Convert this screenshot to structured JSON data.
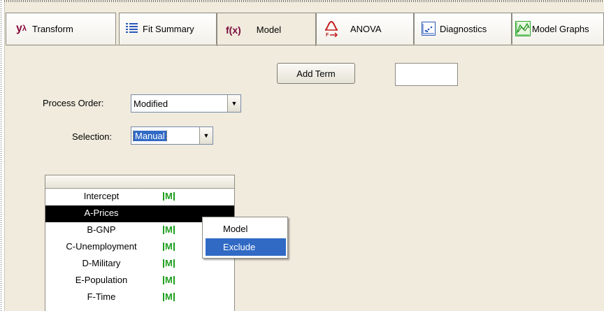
{
  "tabs": [
    {
      "label": "Transform",
      "icon": "y-lambda-icon",
      "glyph": "yλ"
    },
    {
      "label": "Fit Summary",
      "icon": "list-icon"
    },
    {
      "label": "Model",
      "icon": "fx-icon",
      "glyph": "f(x)",
      "active": true
    },
    {
      "label": "ANOVA",
      "icon": "f-test-icon"
    },
    {
      "label": "Diagnostics",
      "icon": "scatter-icon"
    },
    {
      "label": "Model Graphs",
      "icon": "surface-graph-icon"
    }
  ],
  "add_term": {
    "label": "Add Term"
  },
  "term_input": {
    "value": ""
  },
  "process_order": {
    "label": "Process Order:",
    "value": "Modified"
  },
  "selection": {
    "label": "Selection:",
    "value": "Manual"
  },
  "terms": [
    {
      "name": "Intercept",
      "mark": "M"
    },
    {
      "name": "A-Prices",
      "mark": "",
      "selected": true
    },
    {
      "name": "B-GNP",
      "mark": "M"
    },
    {
      "name": "C-Unemployment",
      "mark": "M"
    },
    {
      "name": "D-Military",
      "mark": "M"
    },
    {
      "name": "E-Population",
      "mark": "M"
    },
    {
      "name": "F-Time",
      "mark": "M"
    }
  ],
  "context_menu": {
    "items": [
      "Model",
      "Exclude"
    ],
    "highlighted": "Exclude"
  },
  "colors": {
    "accent": "#316ac5",
    "model_mark": "#1e9f1e",
    "background": "#f0ebdd"
  }
}
